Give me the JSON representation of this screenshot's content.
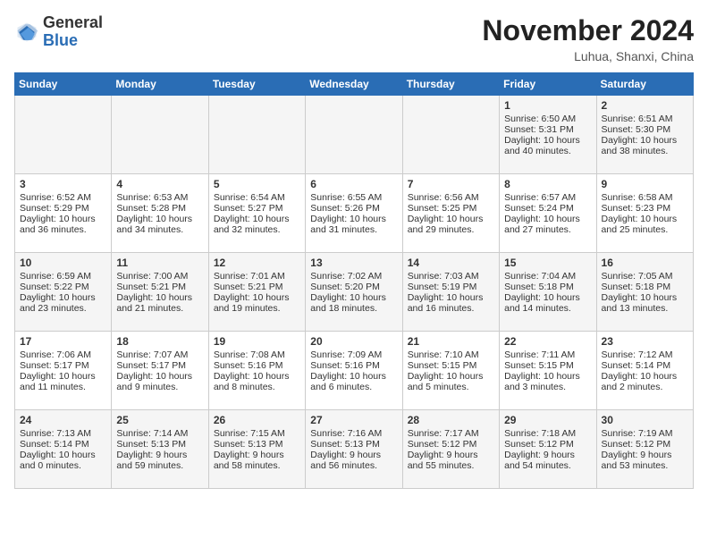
{
  "logo": {
    "general": "General",
    "blue": "Blue"
  },
  "title": "November 2024",
  "location": "Luhua, Shanxi, China",
  "headers": [
    "Sunday",
    "Monday",
    "Tuesday",
    "Wednesday",
    "Thursday",
    "Friday",
    "Saturday"
  ],
  "weeks": [
    [
      {
        "day": "",
        "content": ""
      },
      {
        "day": "",
        "content": ""
      },
      {
        "day": "",
        "content": ""
      },
      {
        "day": "",
        "content": ""
      },
      {
        "day": "",
        "content": ""
      },
      {
        "day": "1",
        "content": "Sunrise: 6:50 AM\nSunset: 5:31 PM\nDaylight: 10 hours and 40 minutes."
      },
      {
        "day": "2",
        "content": "Sunrise: 6:51 AM\nSunset: 5:30 PM\nDaylight: 10 hours and 38 minutes."
      }
    ],
    [
      {
        "day": "3",
        "content": "Sunrise: 6:52 AM\nSunset: 5:29 PM\nDaylight: 10 hours and 36 minutes."
      },
      {
        "day": "4",
        "content": "Sunrise: 6:53 AM\nSunset: 5:28 PM\nDaylight: 10 hours and 34 minutes."
      },
      {
        "day": "5",
        "content": "Sunrise: 6:54 AM\nSunset: 5:27 PM\nDaylight: 10 hours and 32 minutes."
      },
      {
        "day": "6",
        "content": "Sunrise: 6:55 AM\nSunset: 5:26 PM\nDaylight: 10 hours and 31 minutes."
      },
      {
        "day": "7",
        "content": "Sunrise: 6:56 AM\nSunset: 5:25 PM\nDaylight: 10 hours and 29 minutes."
      },
      {
        "day": "8",
        "content": "Sunrise: 6:57 AM\nSunset: 5:24 PM\nDaylight: 10 hours and 27 minutes."
      },
      {
        "day": "9",
        "content": "Sunrise: 6:58 AM\nSunset: 5:23 PM\nDaylight: 10 hours and 25 minutes."
      }
    ],
    [
      {
        "day": "10",
        "content": "Sunrise: 6:59 AM\nSunset: 5:22 PM\nDaylight: 10 hours and 23 minutes."
      },
      {
        "day": "11",
        "content": "Sunrise: 7:00 AM\nSunset: 5:21 PM\nDaylight: 10 hours and 21 minutes."
      },
      {
        "day": "12",
        "content": "Sunrise: 7:01 AM\nSunset: 5:21 PM\nDaylight: 10 hours and 19 minutes."
      },
      {
        "day": "13",
        "content": "Sunrise: 7:02 AM\nSunset: 5:20 PM\nDaylight: 10 hours and 18 minutes."
      },
      {
        "day": "14",
        "content": "Sunrise: 7:03 AM\nSunset: 5:19 PM\nDaylight: 10 hours and 16 minutes."
      },
      {
        "day": "15",
        "content": "Sunrise: 7:04 AM\nSunset: 5:18 PM\nDaylight: 10 hours and 14 minutes."
      },
      {
        "day": "16",
        "content": "Sunrise: 7:05 AM\nSunset: 5:18 PM\nDaylight: 10 hours and 13 minutes."
      }
    ],
    [
      {
        "day": "17",
        "content": "Sunrise: 7:06 AM\nSunset: 5:17 PM\nDaylight: 10 hours and 11 minutes."
      },
      {
        "day": "18",
        "content": "Sunrise: 7:07 AM\nSunset: 5:17 PM\nDaylight: 10 hours and 9 minutes."
      },
      {
        "day": "19",
        "content": "Sunrise: 7:08 AM\nSunset: 5:16 PM\nDaylight: 10 hours and 8 minutes."
      },
      {
        "day": "20",
        "content": "Sunrise: 7:09 AM\nSunset: 5:16 PM\nDaylight: 10 hours and 6 minutes."
      },
      {
        "day": "21",
        "content": "Sunrise: 7:10 AM\nSunset: 5:15 PM\nDaylight: 10 hours and 5 minutes."
      },
      {
        "day": "22",
        "content": "Sunrise: 7:11 AM\nSunset: 5:15 PM\nDaylight: 10 hours and 3 minutes."
      },
      {
        "day": "23",
        "content": "Sunrise: 7:12 AM\nSunset: 5:14 PM\nDaylight: 10 hours and 2 minutes."
      }
    ],
    [
      {
        "day": "24",
        "content": "Sunrise: 7:13 AM\nSunset: 5:14 PM\nDaylight: 10 hours and 0 minutes."
      },
      {
        "day": "25",
        "content": "Sunrise: 7:14 AM\nSunset: 5:13 PM\nDaylight: 9 hours and 59 minutes."
      },
      {
        "day": "26",
        "content": "Sunrise: 7:15 AM\nSunset: 5:13 PM\nDaylight: 9 hours and 58 minutes."
      },
      {
        "day": "27",
        "content": "Sunrise: 7:16 AM\nSunset: 5:13 PM\nDaylight: 9 hours and 56 minutes."
      },
      {
        "day": "28",
        "content": "Sunrise: 7:17 AM\nSunset: 5:12 PM\nDaylight: 9 hours and 55 minutes."
      },
      {
        "day": "29",
        "content": "Sunrise: 7:18 AM\nSunset: 5:12 PM\nDaylight: 9 hours and 54 minutes."
      },
      {
        "day": "30",
        "content": "Sunrise: 7:19 AM\nSunset: 5:12 PM\nDaylight: 9 hours and 53 minutes."
      }
    ]
  ]
}
